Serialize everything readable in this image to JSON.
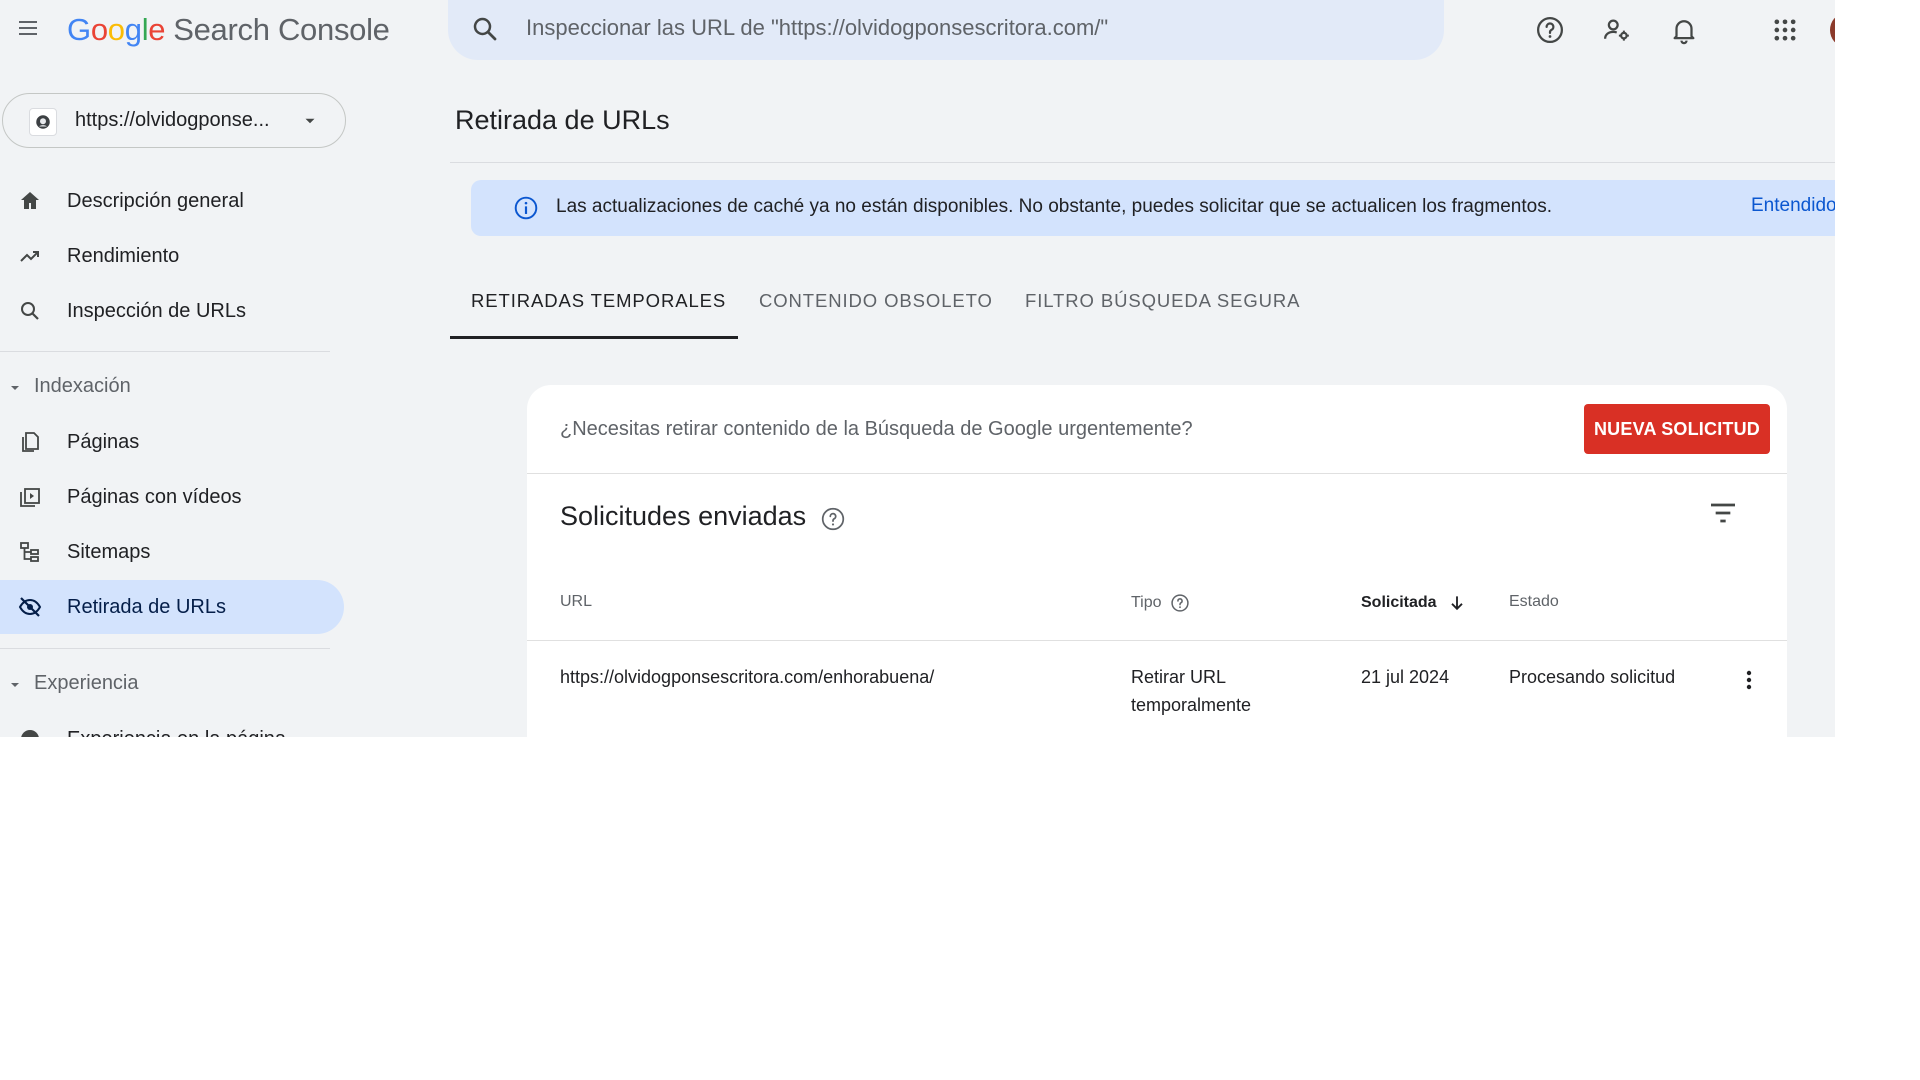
{
  "app": {
    "logo_google": [
      "G",
      "o",
      "o",
      "g",
      "l",
      "e"
    ],
    "product_name": "Search Console"
  },
  "search": {
    "placeholder": "Inspeccionar las URL de \"https://olvidogponsescritora.com/\""
  },
  "top_icons": [
    "help-icon",
    "manage-users-icon",
    "notifications-icon",
    "apps-grid-icon",
    "avatar"
  ],
  "property": {
    "label": "https://olvidogponse..."
  },
  "sidebar": {
    "items": [
      {
        "label": "Descripción general",
        "icon": "home-icon"
      },
      {
        "label": "Rendimiento",
        "icon": "trending-up-icon"
      },
      {
        "label": "Inspección de URLs",
        "icon": "search-icon"
      }
    ],
    "sections": [
      {
        "label": "Indexación",
        "items": [
          {
            "label": "Páginas",
            "icon": "pages-icon"
          },
          {
            "label": "Páginas con vídeos",
            "icon": "video-pages-icon"
          },
          {
            "label": "Sitemaps",
            "icon": "sitemap-icon"
          },
          {
            "label": "Retirada de URLs",
            "icon": "removals-icon",
            "active": true
          }
        ]
      },
      {
        "label": "Experiencia",
        "items": [
          {
            "label": "Experiencia en la página",
            "icon": "page-experience-icon"
          }
        ]
      }
    ]
  },
  "main": {
    "title": "Retirada de URLs",
    "banner": {
      "text": "Las actualizaciones de caché ya no están disponibles. No obstante, puedes solicitar que se actualicen los fragmentos.",
      "action": "Entendido"
    },
    "tabs": [
      {
        "label": "RETIRADAS TEMPORALES",
        "active": true
      },
      {
        "label": "CONTENIDO OBSOLETO",
        "active": false
      },
      {
        "label": "FILTRO BÚSQUEDA SEGURA",
        "active": false
      }
    ],
    "card": {
      "urgent_text": "¿Necesitas retirar contenido de la Búsqueda de Google urgentemente?",
      "new_request_label": "NUEVA SOLICITUD",
      "sent_title": "Solicitudes enviadas",
      "columns": {
        "url": "URL",
        "type": "Tipo",
        "requested": "Solicitada",
        "status": "Estado"
      },
      "rows": [
        {
          "url": "https://olvidogponsescritora.com/enhorabuena/",
          "type_line1": "Retirar URL",
          "type_line2": "temporalmente",
          "requested": "21 jul 2024",
          "status": "Procesando solicitud"
        }
      ]
    }
  },
  "colors": {
    "app_background": "#f1f3f5",
    "search_background": "#e2eaf8",
    "active_nav": "#d3e3fd",
    "banner": "#d3e3fd",
    "primary_button": "#d93025",
    "link_blue": "#0b57d0"
  }
}
